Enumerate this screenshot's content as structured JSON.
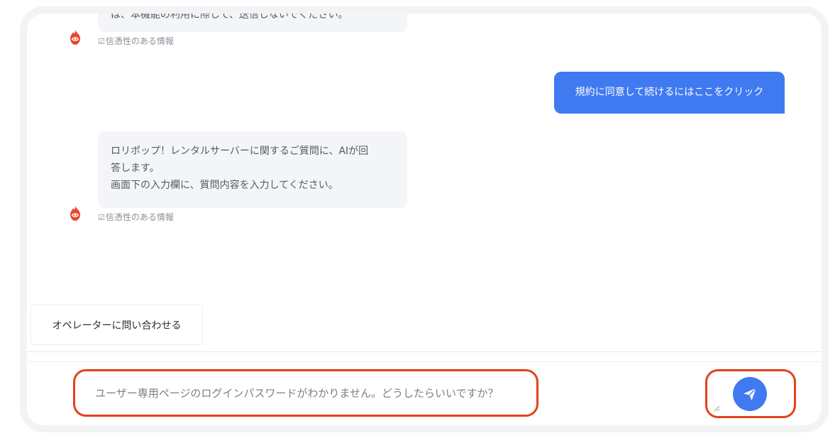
{
  "messages": [
    {
      "role": "bot",
      "lines": [
        "は、本機能の利用に際して、送信しないでください。"
      ],
      "reliability": "信憑性のある情報"
    },
    {
      "role": "user",
      "text": "規約に同意して続けるにはここをクリック"
    },
    {
      "role": "bot",
      "lines": [
        "ロリポップ！レンタルサーバーに関するご質問に、AIが回",
        "答します。",
        "画面下の入力欄に、質問内容を入力してください。"
      ],
      "reliability": "信憑性のある情報"
    }
  ],
  "operator_button": {
    "label": "オペレーターに問い合わせる"
  },
  "input": {
    "value": "ユーザー専用ページのログインパスワードがわかりません。どうしたらいいですか？"
  },
  "icons": {
    "bot": "flame-mascot-icon",
    "reliability": "checkbox-icon",
    "send": "paper-plane-icon",
    "resize": "resize-grip-icon"
  },
  "colors": {
    "accent": "#3f7af1",
    "highlight": "#e2421c",
    "bot_bubble": "#f4f5f8",
    "mascot": "#e8472a"
  }
}
